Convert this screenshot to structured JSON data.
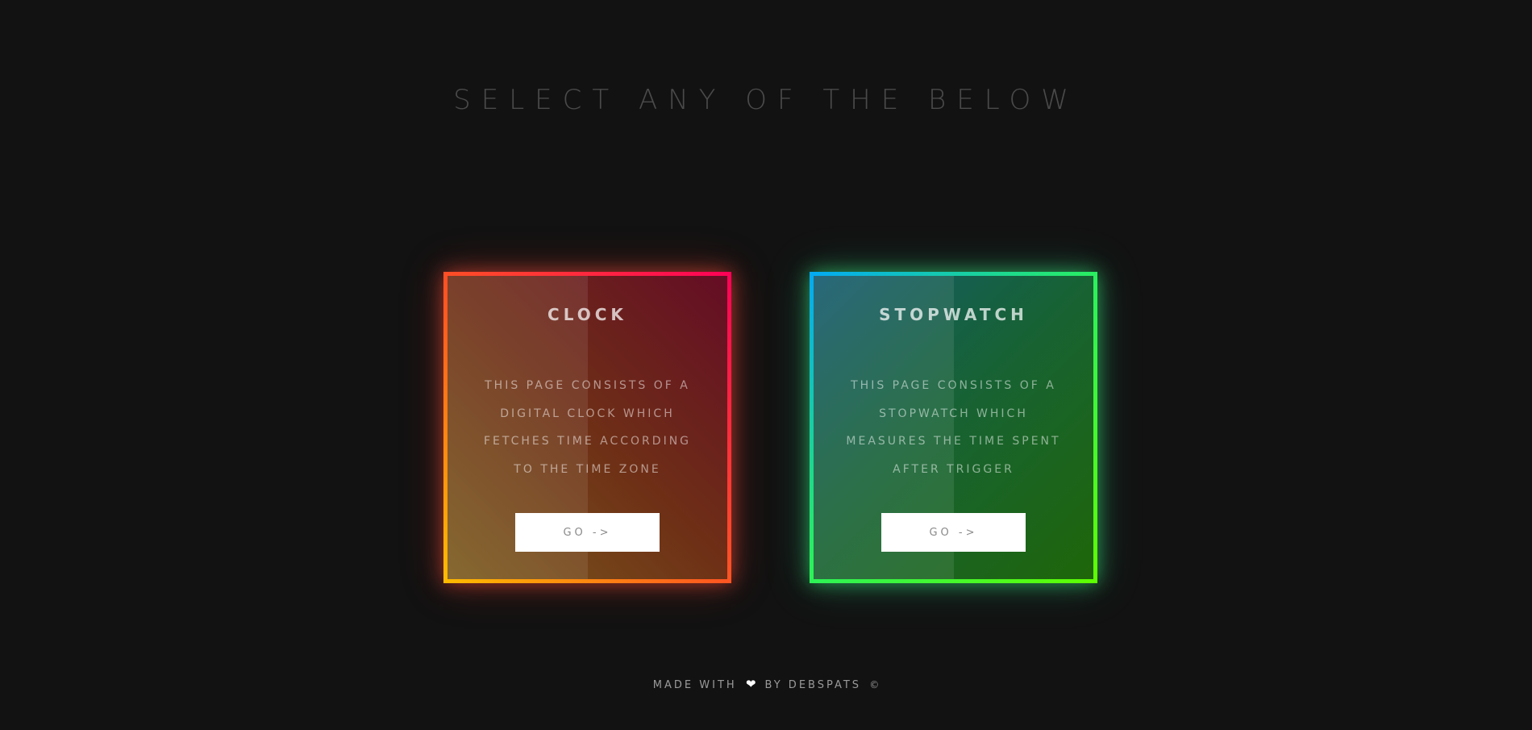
{
  "page": {
    "heading": "SELECT ANY OF THE BELOW"
  },
  "cards": [
    {
      "title": "CLOCK",
      "description": "THIS PAGE CONSISTS OF A DIGITAL CLOCK WHICH FETCHES TIME ACCORDING TO THE TIME ZONE",
      "button_label": "GO ->",
      "colors": {
        "border_start": "#ffbc00",
        "border_mid": "#ff5a1f",
        "border_end": "#ff0058"
      }
    },
    {
      "title": "STOPWATCH",
      "description": "THIS PAGE CONSISTS OF A STOPWATCH WHICH MEASURES THE TIME SPENT AFTER TRIGGER",
      "button_label": "GO ->",
      "colors": {
        "border_start": "#03a9f4",
        "border_mid": "#2bf25a",
        "border_end": "#5fff00"
      }
    }
  ],
  "footer": {
    "made_with": "MADE WITH",
    "heart_icon": "heart-icon",
    "by": "BY DEBSPATS",
    "copyright": "©"
  },
  "colors": {
    "background": "#121212",
    "heading": "#4a4a4a",
    "button_bg": "#ffffff"
  }
}
